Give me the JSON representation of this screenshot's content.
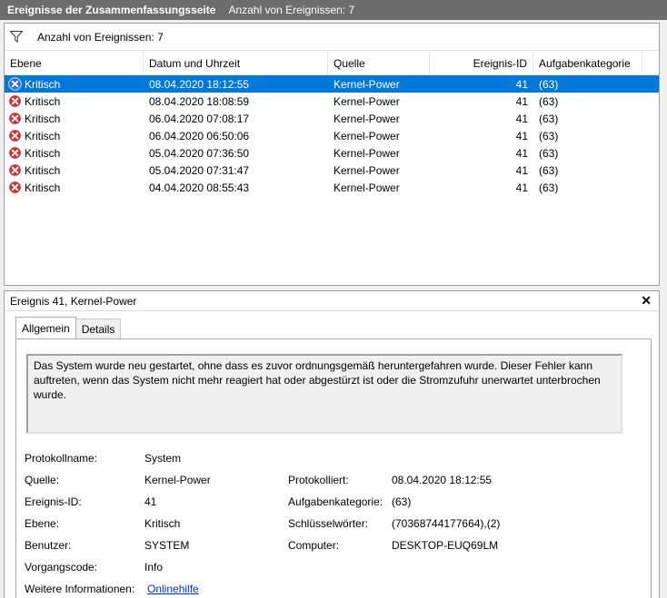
{
  "titlebar": {
    "title": "Ereignisse der Zusammenfassungsseite",
    "count": "Anzahl von Ereignissen: 7"
  },
  "filter": {
    "icon": "filter-icon",
    "count": "Anzahl von Ereignissen: 7"
  },
  "table": {
    "columns": [
      "Ebene",
      "Datum und Uhrzeit",
      "Quelle",
      "Ereignis-ID",
      "Aufgabenkategorie"
    ],
    "rows": [
      {
        "level": "Kritisch",
        "date": "08.04.2020 18:12:55",
        "source": "Kernel-Power",
        "id": "41",
        "category": "(63)"
      },
      {
        "level": "Kritisch",
        "date": "08.04.2020 18:08:59",
        "source": "Kernel-Power",
        "id": "41",
        "category": "(63)"
      },
      {
        "level": "Kritisch",
        "date": "06.04.2020 07:08:17",
        "source": "Kernel-Power",
        "id": "41",
        "category": "(63)"
      },
      {
        "level": "Kritisch",
        "date": "06.04.2020 06:50:06",
        "source": "Kernel-Power",
        "id": "41",
        "category": "(63)"
      },
      {
        "level": "Kritisch",
        "date": "05.04.2020 07:36:50",
        "source": "Kernel-Power",
        "id": "41",
        "category": "(63)"
      },
      {
        "level": "Kritisch",
        "date": "05.04.2020 07:31:47",
        "source": "Kernel-Power",
        "id": "41",
        "category": "(63)"
      },
      {
        "level": "Kritisch",
        "date": "04.04.2020 08:55:43",
        "source": "Kernel-Power",
        "id": "41",
        "category": "(63)"
      }
    ]
  },
  "detail": {
    "title": "Ereignis 41, Kernel-Power",
    "close": "✕",
    "tabs": [
      "Allgemein",
      "Details"
    ],
    "description": "Das System wurde neu gestartet, ohne dass es zuvor ordnungsgemäß heruntergefahren wurde. Dieser Fehler kann auftreten, wenn das System nicht mehr reagiert hat oder abgestürzt ist oder die Stromzufuhr unerwartet unterbrochen wurde.",
    "left": [
      {
        "label": "Protokollname:",
        "value": "System"
      },
      {
        "label": "Quelle:",
        "value": "Kernel-Power"
      },
      {
        "label": "Ereignis-ID:",
        "value": "41"
      },
      {
        "label": "Ebene:",
        "value": "Kritisch"
      },
      {
        "label": "Benutzer:",
        "value": "SYSTEM"
      },
      {
        "label": "Vorgangscode:",
        "value": "Info"
      },
      {
        "label": "Weitere Informationen:",
        "value": "Onlinehilfe"
      }
    ],
    "right": [
      {
        "label": "Protokolliert:",
        "value": "08.04.2020 18:12:55"
      },
      {
        "label": "Aufgabenkategorie:",
        "value": "(63)"
      },
      {
        "label": "Schlüsselwörter:",
        "value": "(70368744177664),(2)"
      },
      {
        "label": "Computer:",
        "value": "DESKTOP-EUQ69LM"
      }
    ]
  },
  "colors": {
    "selection": "#0078d7",
    "error": "#d13438",
    "link": "#0033cc",
    "titlebar": "#6d6d6d"
  }
}
